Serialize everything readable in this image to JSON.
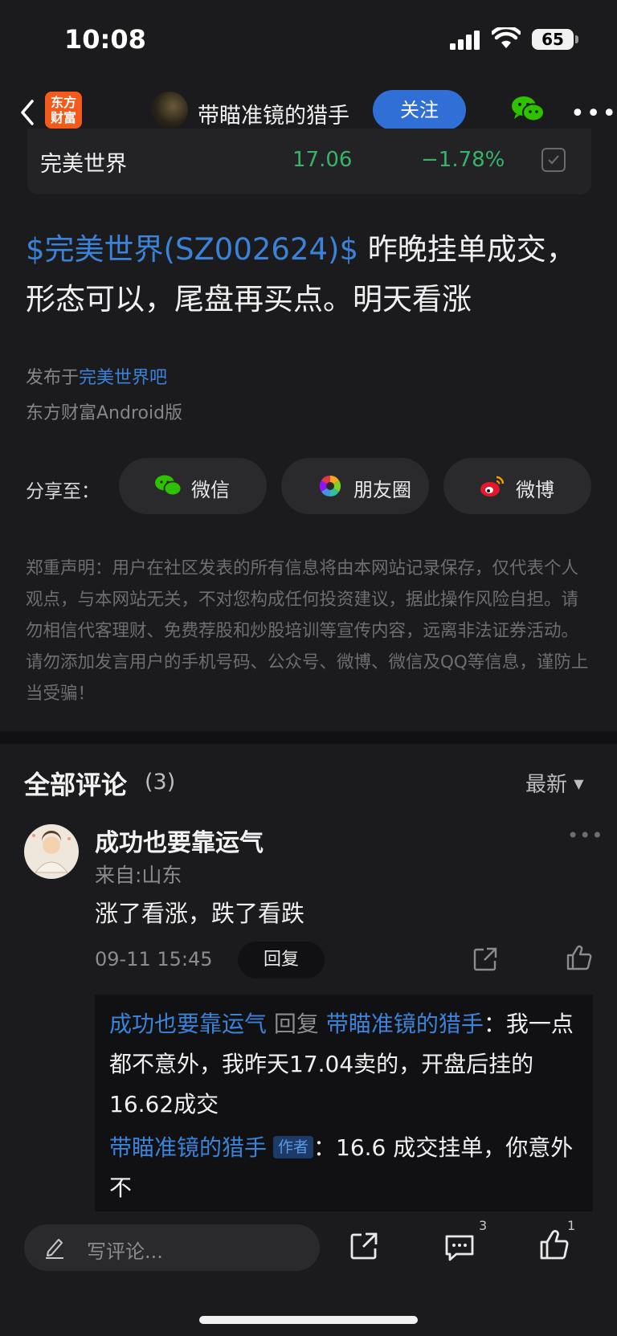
{
  "status_bar": {
    "time": "10:08",
    "battery": "65"
  },
  "nav": {
    "logo_text": "东方\n财富",
    "author_name": "带瞄准镜的猎手",
    "follow_label": "关注"
  },
  "stock": {
    "name": "完美世界",
    "price": "17.06",
    "change": "−1.78%"
  },
  "post": {
    "tag": "$完美世界(SZ002624)$",
    "body": " 昨晚挂单成交，形态可以，尾盘再买点。明天看涨",
    "published_prefix": "发布于",
    "board": "完美世界吧",
    "client": "东方财富Android版"
  },
  "share": {
    "label": "分享至：",
    "items": [
      {
        "label": "微信",
        "icon": "wechat-icon"
      },
      {
        "label": "朋友圈",
        "icon": "moments-icon"
      },
      {
        "label": "微博",
        "icon": "weibo-icon"
      }
    ]
  },
  "disclaimer": "郑重声明：用户在社区发表的所有信息将由本网站记录保存，仅代表个人观点，与本网站无关，不对您构成任何投资建议，据此操作风险自担。请勿相信代客理财、免费荐股和炒股培训等宣传内容，远离非法证券活动。请勿添加发言用户的手机号码、公众号、微博、微信及QQ等信息，谨防上当受骗！",
  "comments": {
    "title": "全部评论",
    "count": "(3)",
    "sort_label": "最新",
    "items": [
      {
        "user": "成功也要靠运气",
        "from": "来自:山东",
        "text": "涨了看涨，跌了看跌",
        "time": "09-11 15:45",
        "reply_label": "回复",
        "replies": [
          {
            "from_user": "成功也要靠运气",
            "reply_word": " 回复 ",
            "to_user": "带瞄准镜的猎手",
            "text": "：我一点都不意外，我昨天17.04卖的，开盘后挂的16.62成交"
          },
          {
            "from_user": "带瞄准镜的猎手",
            "badge": "作者",
            "text": "：16.6 成交挂单，你意外不"
          }
        ]
      }
    ]
  },
  "bottom_bar": {
    "placeholder": "写评论...",
    "comment_count": "3",
    "like_count": "1"
  },
  "colors": {
    "accent_blue": "#3b82d9",
    "down_green": "#39b36a",
    "background": "#1b1b1d"
  }
}
